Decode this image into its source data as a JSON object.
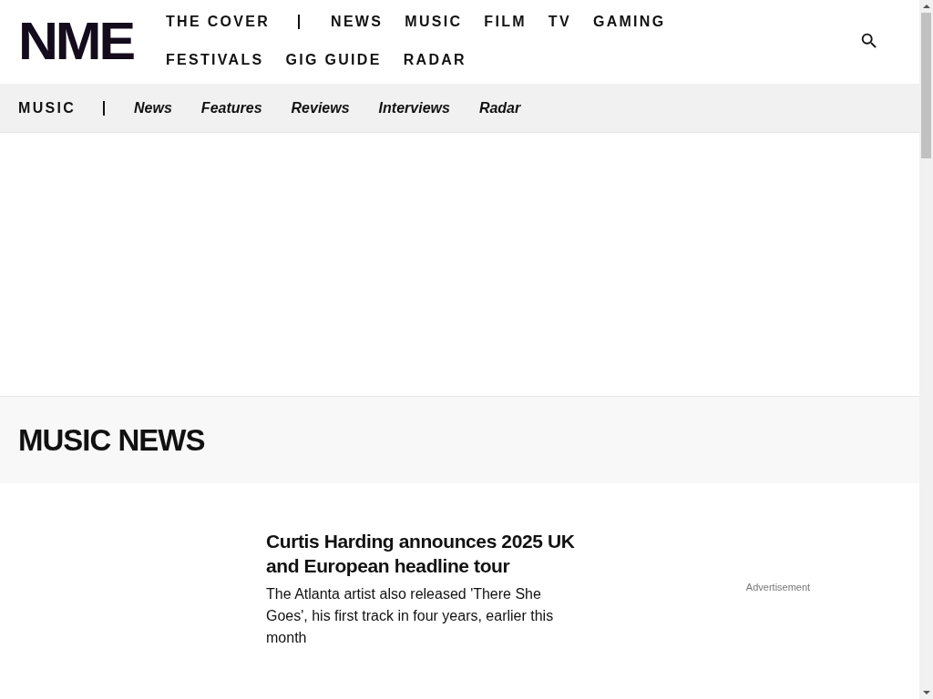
{
  "logo": "NME",
  "main_nav": [
    {
      "label": "THE COVER"
    },
    {
      "label": "NEWS"
    },
    {
      "label": "MUSIC"
    },
    {
      "label": "FILM"
    },
    {
      "label": "TV"
    },
    {
      "label": "GAMING"
    },
    {
      "label": "FESTIVALS"
    },
    {
      "label": "GIG GUIDE"
    },
    {
      "label": "RADAR"
    }
  ],
  "section_nav": {
    "section": "MUSIC",
    "links": [
      "News",
      "Features",
      "Reviews",
      "Interviews",
      "Radar"
    ]
  },
  "page_title": "MUSIC NEWS",
  "articles": [
    {
      "title": "Curtis Harding announces 2025 UK and European headline tour",
      "summary": "The Atlanta artist also released 'There She Goes', his first track in four years, earlier this month"
    }
  ],
  "ad_label": "Advertisement"
}
